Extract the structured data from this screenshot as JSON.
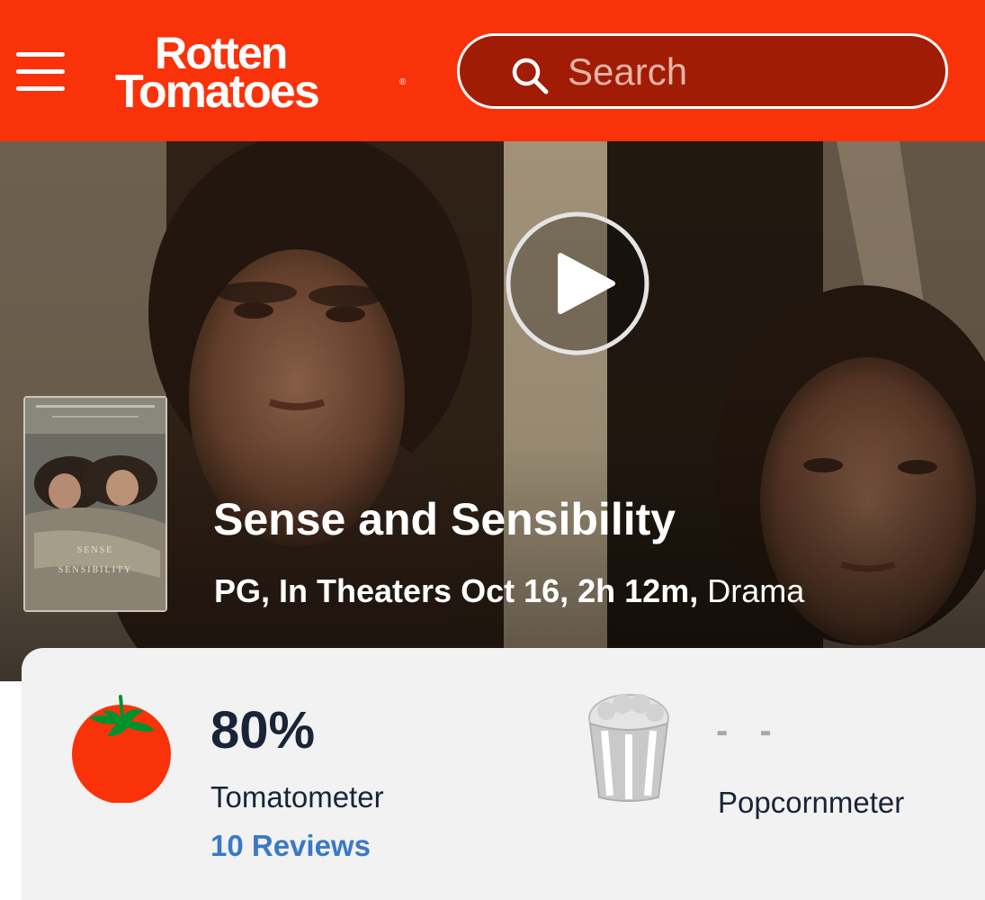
{
  "header": {
    "logo_line1": "Rotten",
    "logo_line2": "Tomatoes",
    "brand_color": "#fa320a",
    "search_placeholder": "Search"
  },
  "hero": {
    "title": "Sense and Sensibility",
    "meta_bold": "PG, In Theaters Oct 16, 2h 12m,",
    "meta_genre": "Drama",
    "poster_title_line1": "SENSE",
    "poster_title_line2": "SENSIBILITY"
  },
  "scores": {
    "tomatometer_value": "80%",
    "tomatometer_label": "Tomatometer",
    "reviews_link": "10 Reviews",
    "popcornmeter_value": "- -",
    "popcornmeter_label": "Popcornmeter",
    "link_color": "#3a78c9"
  },
  "icons": [
    "menu-icon",
    "search-icon",
    "play-icon",
    "tomato-icon",
    "popcorn-bucket-icon"
  ]
}
